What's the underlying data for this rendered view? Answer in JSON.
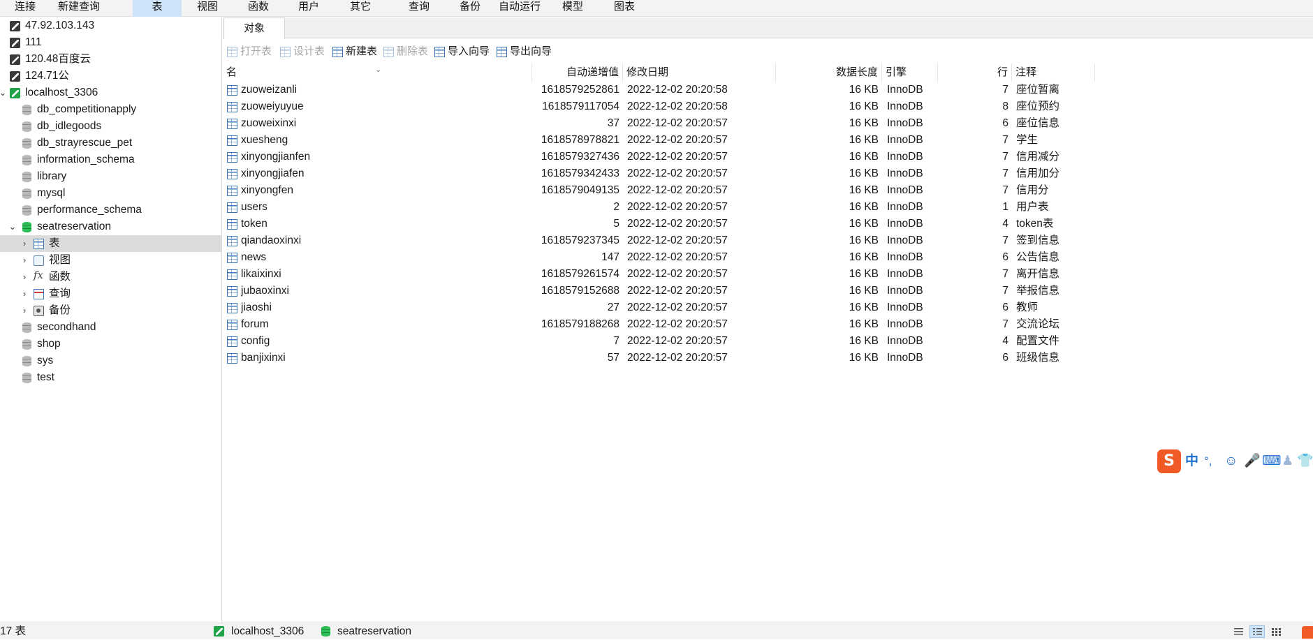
{
  "menu": {
    "items": [
      "连接",
      "新建查询",
      "表",
      "视图",
      "函数",
      "用户",
      "其它",
      "查询",
      "备份",
      "自动运行",
      "模型",
      "图表"
    ],
    "active": "表"
  },
  "tree": {
    "connections_top": [
      "47.92.103.143",
      "111",
      "120.48百度云",
      "124.71公"
    ],
    "localhost": {
      "label": "localhost_3306",
      "databases_before": [
        "db_competitionapply",
        "db_idlegoods",
        "db_strayrescue_pet",
        "information_schema",
        "library",
        "mysql",
        "performance_schema"
      ],
      "open_db": {
        "label": "seatreservation",
        "children": [
          {
            "label": "表",
            "icon": "table-icon",
            "selected": true
          },
          {
            "label": "视图",
            "icon": "view-icon"
          },
          {
            "label": "函数",
            "icon": "function-icon"
          },
          {
            "label": "查询",
            "icon": "query-icon"
          },
          {
            "label": "备份",
            "icon": "backup-icon"
          }
        ]
      },
      "databases_after": [
        "secondhand",
        "shop",
        "sys",
        "test"
      ]
    }
  },
  "tab": {
    "label": "对象"
  },
  "toolbar": {
    "open_table": "打开表",
    "design_table": "设计表",
    "new_table": "新建表",
    "delete_table": "删除表",
    "import_wizard": "导入向导",
    "export_wizard": "导出向导"
  },
  "table": {
    "headers": {
      "name": "名",
      "auto_inc": "自动递增值",
      "modified": "修改日期",
      "data_length": "数据长度",
      "engine": "引擎",
      "rows": "行",
      "comment": "注释"
    },
    "rows": [
      {
        "name": "zuoweizanli",
        "auto_inc": "1618579252861",
        "modified": "2022-12-02 20:20:58",
        "size": "16 KB",
        "engine": "InnoDB",
        "rows": "7",
        "comment": "座位暂离"
      },
      {
        "name": "zuoweiyuyue",
        "auto_inc": "1618579117054",
        "modified": "2022-12-02 20:20:58",
        "size": "16 KB",
        "engine": "InnoDB",
        "rows": "8",
        "comment": "座位预约"
      },
      {
        "name": "zuoweixinxi",
        "auto_inc": "37",
        "modified": "2022-12-02 20:20:57",
        "size": "16 KB",
        "engine": "InnoDB",
        "rows": "6",
        "comment": "座位信息"
      },
      {
        "name": "xuesheng",
        "auto_inc": "1618578978821",
        "modified": "2022-12-02 20:20:57",
        "size": "16 KB",
        "engine": "InnoDB",
        "rows": "7",
        "comment": "学生"
      },
      {
        "name": "xinyongjianfen",
        "auto_inc": "1618579327436",
        "modified": "2022-12-02 20:20:57",
        "size": "16 KB",
        "engine": "InnoDB",
        "rows": "7",
        "comment": "信用减分"
      },
      {
        "name": "xinyongjiafen",
        "auto_inc": "1618579342433",
        "modified": "2022-12-02 20:20:57",
        "size": "16 KB",
        "engine": "InnoDB",
        "rows": "7",
        "comment": "信用加分"
      },
      {
        "name": "xinyongfen",
        "auto_inc": "1618579049135",
        "modified": "2022-12-02 20:20:57",
        "size": "16 KB",
        "engine": "InnoDB",
        "rows": "7",
        "comment": "信用分"
      },
      {
        "name": "users",
        "auto_inc": "2",
        "modified": "2022-12-02 20:20:57",
        "size": "16 KB",
        "engine": "InnoDB",
        "rows": "1",
        "comment": "用户表"
      },
      {
        "name": "token",
        "auto_inc": "5",
        "modified": "2022-12-02 20:20:57",
        "size": "16 KB",
        "engine": "InnoDB",
        "rows": "4",
        "comment": "token表"
      },
      {
        "name": "qiandaoxinxi",
        "auto_inc": "1618579237345",
        "modified": "2022-12-02 20:20:57",
        "size": "16 KB",
        "engine": "InnoDB",
        "rows": "7",
        "comment": "签到信息"
      },
      {
        "name": "news",
        "auto_inc": "147",
        "modified": "2022-12-02 20:20:57",
        "size": "16 KB",
        "engine": "InnoDB",
        "rows": "6",
        "comment": "公告信息"
      },
      {
        "name": "likaixinxi",
        "auto_inc": "1618579261574",
        "modified": "2022-12-02 20:20:57",
        "size": "16 KB",
        "engine": "InnoDB",
        "rows": "7",
        "comment": "离开信息"
      },
      {
        "name": "jubaoxinxi",
        "auto_inc": "1618579152688",
        "modified": "2022-12-02 20:20:57",
        "size": "16 KB",
        "engine": "InnoDB",
        "rows": "7",
        "comment": "举报信息"
      },
      {
        "name": "jiaoshi",
        "auto_inc": "27",
        "modified": "2022-12-02 20:20:57",
        "size": "16 KB",
        "engine": "InnoDB",
        "rows": "6",
        "comment": "教师"
      },
      {
        "name": "forum",
        "auto_inc": "1618579188268",
        "modified": "2022-12-02 20:20:57",
        "size": "16 KB",
        "engine": "InnoDB",
        "rows": "7",
        "comment": "交流论坛"
      },
      {
        "name": "config",
        "auto_inc": "7",
        "modified": "2022-12-02 20:20:57",
        "size": "16 KB",
        "engine": "InnoDB",
        "rows": "4",
        "comment": "配置文件"
      },
      {
        "name": "banjixinxi",
        "auto_inc": "57",
        "modified": "2022-12-02 20:20:57",
        "size": "16 KB",
        "engine": "InnoDB",
        "rows": "6",
        "comment": "班级信息"
      }
    ]
  },
  "ime": {
    "logo": "S",
    "mode": "中",
    "punct": "°,"
  },
  "status": {
    "count": "17 表",
    "connection": "localhost_3306",
    "database": "seatreservation"
  },
  "colors": {
    "accent": "#cfe3f8",
    "selected_tree": "#dcdcdc",
    "db_green": "#2fbd55",
    "conn_green": "#21a447",
    "ime_orange": "#f05a24"
  }
}
